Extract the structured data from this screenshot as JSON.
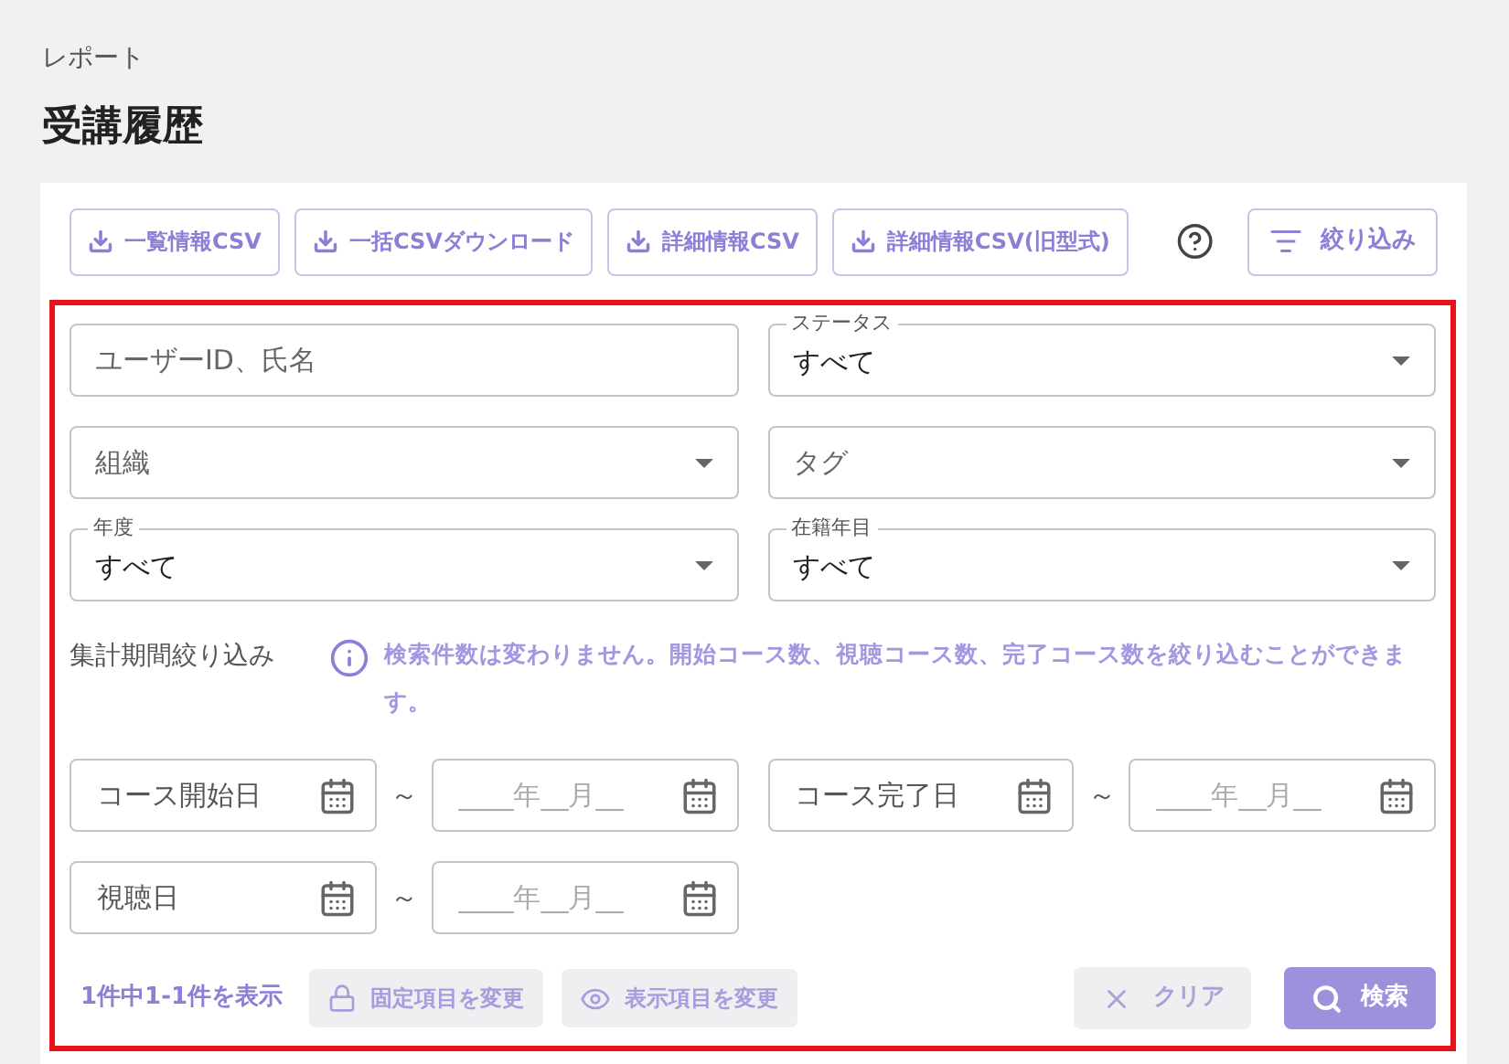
{
  "breadcrumb": "レポート",
  "title": "受講履歴",
  "toolbar": [
    {
      "label": "一覧情報CSV"
    },
    {
      "label": "一括CSVダウンロード"
    },
    {
      "label": "詳細情報CSV"
    },
    {
      "label": "詳細情報CSV(旧型式)"
    }
  ],
  "filter_button": "絞り込み",
  "field_rows": [
    {
      "fields": [
        {
          "kind": "text",
          "placeholder": "ユーザーID、氏名"
        },
        {
          "kind": "select",
          "label": "ステータス",
          "value": "すべて"
        }
      ]
    },
    {
      "fields": [
        {
          "kind": "select",
          "placeholder": "組織"
        },
        {
          "kind": "select",
          "placeholder": "タグ"
        }
      ]
    },
    {
      "fields": [
        {
          "kind": "select",
          "label": "年度",
          "value": "すべて"
        },
        {
          "kind": "select",
          "label": "在籍年目",
          "value": "すべて"
        }
      ]
    }
  ],
  "period": {
    "label": "集計期間絞り込み",
    "note": "検索件数は変わりません。開始コース数、視聴コース数、完了コース数を絞り込むことができます。"
  },
  "date_ranges": [
    {
      "from": "コース開始日",
      "separator": "～",
      "to": "____年__月__"
    },
    {
      "from": "コース完了日",
      "separator": "～",
      "to": "____年__月__"
    },
    {
      "from": "視聴日",
      "separator": "～",
      "to": "____年__月__"
    }
  ],
  "result_count": "1件中1-1件を表示",
  "actions": [
    {
      "kind": "lock",
      "label": "固定項目を変更"
    },
    {
      "kind": "eye",
      "label": "表示項目を変更"
    }
  ],
  "clear_button": "クリア",
  "search_button": "検索"
}
